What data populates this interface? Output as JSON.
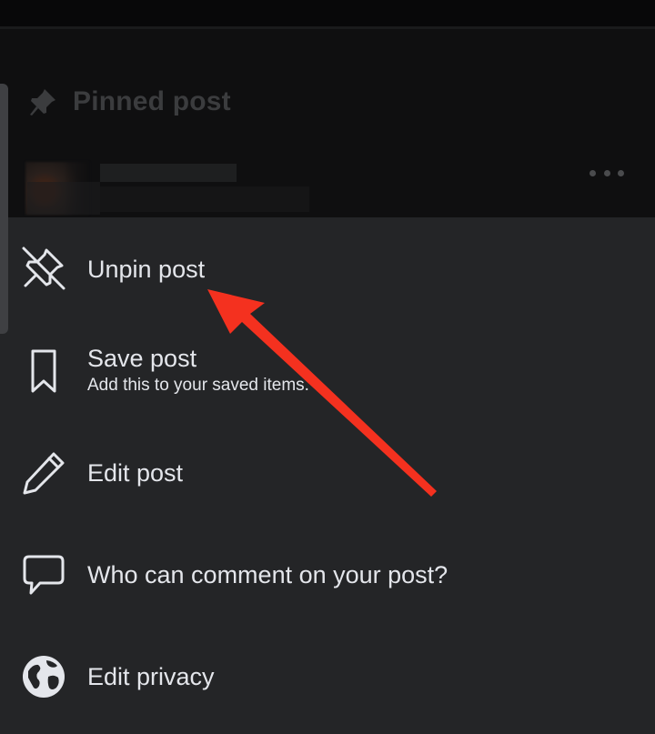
{
  "pinned": {
    "label": "Pinned post"
  },
  "menu": {
    "items": [
      {
        "label": "Unpin post",
        "icon": "unpin-icon"
      },
      {
        "label": "Save post",
        "sublabel": "Add this to your saved items.",
        "icon": "bookmark-icon"
      },
      {
        "label": "Edit post",
        "icon": "pencil-icon"
      },
      {
        "label": "Who can comment on your post?",
        "icon": "comment-icon"
      },
      {
        "label": "Edit privacy",
        "icon": "globe-icon"
      }
    ]
  },
  "colors": {
    "sheet_background": "#242527",
    "text": "#e4e6eb",
    "annotation_arrow": "#f4311f",
    "muted_header": "#3b3c3e"
  }
}
